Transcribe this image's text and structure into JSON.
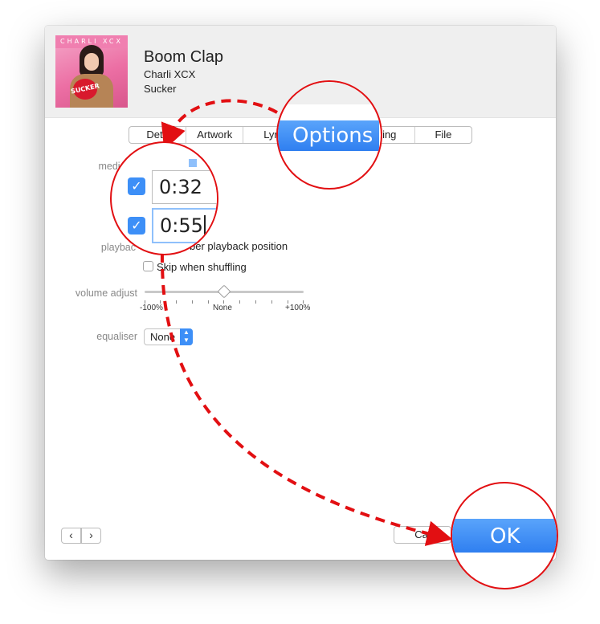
{
  "song": {
    "title": "Boom Clap",
    "artist": "Charli XCX",
    "album": "Sucker"
  },
  "artwork": {
    "band_text": "CHARLI XCX",
    "heart_text": "SUCKER"
  },
  "tabs": [
    "Details",
    "Artwork",
    "Lyrics",
    "Options",
    "Sorting",
    "File"
  ],
  "tabs_visible": [
    "Deta",
    "Artwork",
    "Lyri",
    "",
    "rting",
    "File"
  ],
  "options": {
    "media_kind_label": "media ki",
    "playback_label": "playbac",
    "remember_playback": "ber playback position",
    "skip_shuffling": "Skip when shuffling",
    "volume_label": "volume adjust",
    "volume_min": "-100%",
    "volume_mid": "None",
    "volume_max": "+100%",
    "volume_value": 0,
    "equaliser_label": "equaliser",
    "equaliser_value": "None"
  },
  "zoom": {
    "options_tab": "Options",
    "start_time": "0:32",
    "stop_time": "0:55",
    "start_checked": true,
    "stop_checked": true,
    "ok_label": "OK"
  },
  "footer": {
    "cancel_label": "Cancel",
    "cancel_visible": "Cal",
    "ok_label": "OK"
  },
  "colors": {
    "accent": "#3d8ff7",
    "annotation": "#e20f12"
  }
}
